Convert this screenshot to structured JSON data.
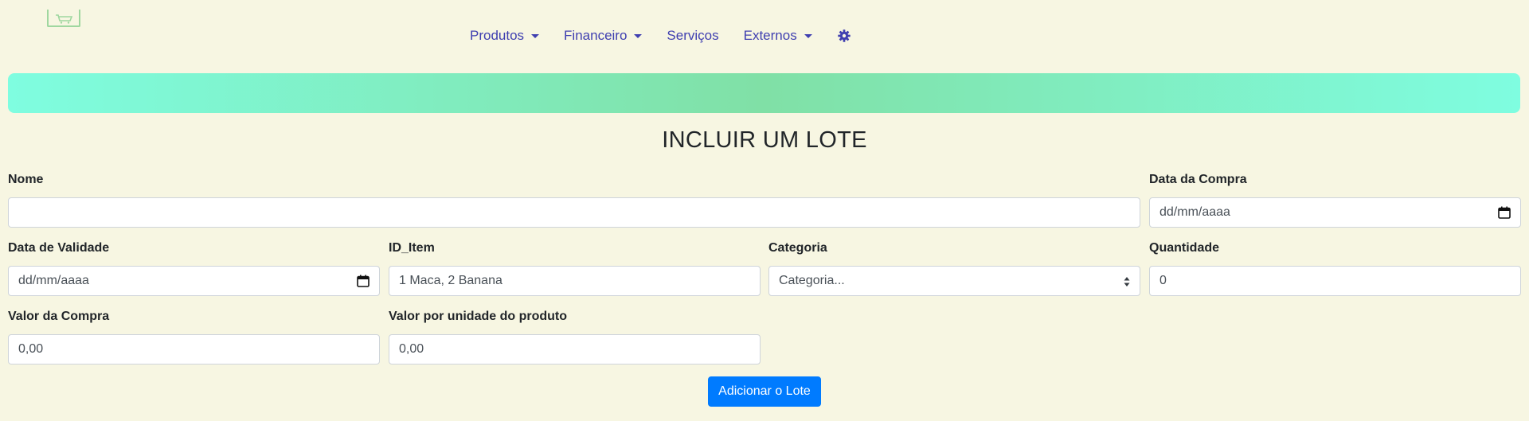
{
  "nav": {
    "items": [
      {
        "label": "Produtos",
        "dropdown": true
      },
      {
        "label": "Financeiro",
        "dropdown": true
      },
      {
        "label": "Serviços",
        "dropdown": false
      },
      {
        "label": "Externos",
        "dropdown": true
      }
    ],
    "settings_icon": "gear-icon",
    "logo_icon": "cart-icon"
  },
  "colors": {
    "page_bg": "#f7f6e2",
    "nav_link": "#3f3fb0",
    "banner_edge": "#7ffde0",
    "banner_center": "#80e0a6",
    "primary_button": "#007bff"
  },
  "page": {
    "title": "INCLUIR UM LOTE"
  },
  "form": {
    "nome": {
      "label": "Nome",
      "value": ""
    },
    "data_compra": {
      "label": "Data da Compra",
      "placeholder": "dd/mm/aaaa",
      "icon": "calendar-icon"
    },
    "data_validade": {
      "label": "Data de Validade",
      "placeholder": "dd/mm/aaaa",
      "icon": "calendar-icon"
    },
    "id_item": {
      "label": "ID_Item",
      "placeholder": "1 Maca, 2 Banana"
    },
    "categoria": {
      "label": "Categoria",
      "selected": "Categoria..."
    },
    "quantidade": {
      "label": "Quantidade",
      "value": "0"
    },
    "valor_compra": {
      "label": "Valor da Compra",
      "value": "0,00"
    },
    "valor_unidade": {
      "label": "Valor por unidade do produto",
      "value": "0,00"
    },
    "submit_label": "Adicionar o Lote"
  }
}
